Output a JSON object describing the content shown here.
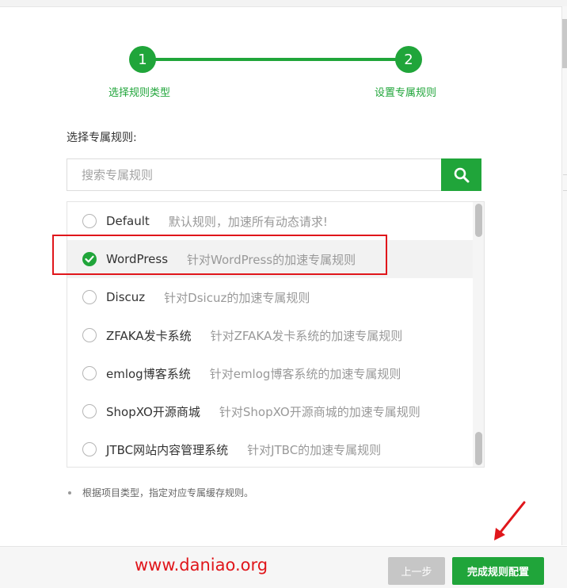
{
  "stepper": {
    "steps": [
      {
        "number": "1",
        "label": "选择规则类型"
      },
      {
        "number": "2",
        "label": "设置专属规则"
      }
    ]
  },
  "form": {
    "label": "选择专属规则:",
    "search_placeholder": "搜索专属规则"
  },
  "rules": [
    {
      "name": "Default",
      "desc": "默认规则，加速所有动态请求!",
      "selected": false
    },
    {
      "name": "WordPress",
      "desc": "针对WordPress的加速专属规则",
      "selected": true
    },
    {
      "name": "Discuz",
      "desc": "针对Dsicuz的加速专属规则",
      "selected": false
    },
    {
      "name": "ZFAKA发卡系统",
      "desc": "针对ZFAKA发卡系统的加速专属规则",
      "selected": false
    },
    {
      "name": "emlog博客系统",
      "desc": "针对emlog博客系统的加速专属规则",
      "selected": false
    },
    {
      "name": "ShopXO开源商城",
      "desc": "针对ShopXO开源商城的加速专属规则",
      "selected": false
    },
    {
      "name": "JTBC网站内容管理系统",
      "desc": "针对JTBC的加速专属规则",
      "selected": false
    }
  ],
  "tip": "根据项目类型，指定对应专属缓存规则。",
  "footer": {
    "watermark": "www.daniao.org",
    "prev_label": "上一步",
    "finish_label": "完成规则配置"
  },
  "colors": {
    "accent": "#20a53a",
    "annotation": "#e0161b",
    "disabled": "#c6c6c6"
  },
  "icons": {
    "search": "search-icon",
    "checked": "check-icon",
    "annotation_arrow": "arrow-icon"
  }
}
